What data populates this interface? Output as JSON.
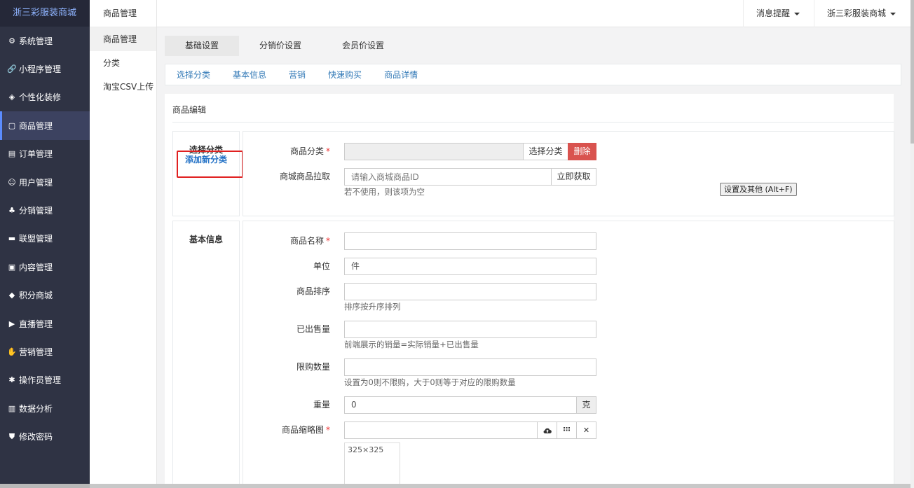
{
  "app": {
    "brand": "浙三彩服装商城"
  },
  "sidebar": {
    "items": [
      {
        "label": "系统管理",
        "icon": "gear-icon",
        "glyph": "⚙"
      },
      {
        "label": "小程序管理",
        "icon": "link-icon",
        "glyph": "🔗"
      },
      {
        "label": "个性化装修",
        "icon": "layers-icon",
        "glyph": "◈"
      },
      {
        "label": "商品管理",
        "icon": "bag-icon",
        "glyph": "▢",
        "active": true
      },
      {
        "label": "订单管理",
        "icon": "calendar-icon",
        "glyph": "▤"
      },
      {
        "label": "用户管理",
        "icon": "user-icon",
        "glyph": "☺"
      },
      {
        "label": "分销管理",
        "icon": "sitemap-icon",
        "glyph": "♣"
      },
      {
        "label": "联盟管理",
        "icon": "store-icon",
        "glyph": "▬"
      },
      {
        "label": "内容管理",
        "icon": "content-icon",
        "glyph": "▣"
      },
      {
        "label": "积分商城",
        "icon": "cube-icon",
        "glyph": "◆"
      },
      {
        "label": "直播管理",
        "icon": "play-icon",
        "glyph": "▶"
      },
      {
        "label": "营销管理",
        "icon": "marketing-icon",
        "glyph": "✋"
      },
      {
        "label": "操作员管理",
        "icon": "cog-icon",
        "glyph": "✱"
      },
      {
        "label": "数据分析",
        "icon": "bar-chart-icon",
        "glyph": "▥"
      },
      {
        "label": "修改密码",
        "icon": "shield-icon",
        "glyph": "⛊"
      }
    ]
  },
  "subnav": {
    "title": "商品管理",
    "items": [
      "商品管理",
      "分类",
      "淘宝CSV上传"
    ]
  },
  "topbar": {
    "messages": "消息提醒",
    "shop": "浙三彩服装商城"
  },
  "tabs": [
    "基础设置",
    "分销价设置",
    "会员价设置"
  ],
  "anchors": [
    "选择分类",
    "基本信息",
    "营销",
    "快速购买",
    "商品详情"
  ],
  "panel": {
    "title": "商品编辑"
  },
  "section_category": {
    "label": "选择分类",
    "add_link": "添加新分类",
    "category_label": "商品分类",
    "category_value": "",
    "select_btn": "选择分类",
    "delete_btn": "删除",
    "pull_label": "商城商品拉取",
    "pull_placeholder": "请输入商城商品ID",
    "pull_btn": "立即获取",
    "pull_help": "若不使用，则该项为空",
    "tooltip": "设置及其他 (Alt+F)"
  },
  "section_basic": {
    "label": "基本信息",
    "name_label": "商品名称",
    "name_value": "",
    "unit_label": "单位",
    "unit_value": "件",
    "sort_label": "商品排序",
    "sort_value": "",
    "sort_help": "排序按升序排列",
    "sold_label": "已出售量",
    "sold_value": "",
    "sold_help": "前端展示的销量=实际销量+已出售量",
    "limit_label": "限购数量",
    "limit_value": "",
    "limit_help": "设置为0则不限购，大于0则等于对应的限购数量",
    "weight_label": "重量",
    "weight_value": "0",
    "weight_unit": "克",
    "thumb_label": "商品缩略图",
    "thumb_value": "",
    "thumb_size": "325×325"
  }
}
